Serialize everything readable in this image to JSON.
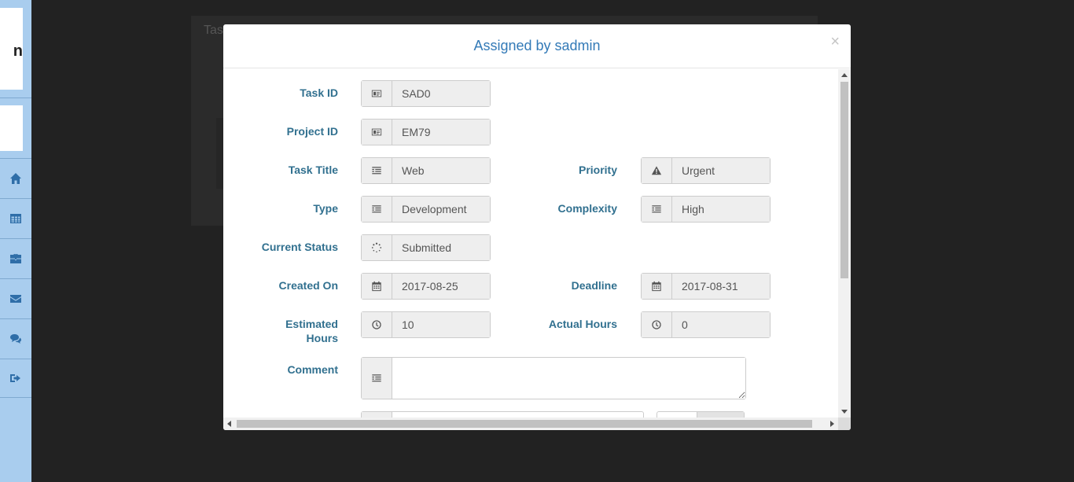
{
  "background": {
    "title": "Tas"
  },
  "sidebar": {
    "logo_letter": "n",
    "items": [
      {
        "icon": "home-icon"
      },
      {
        "icon": "table-icon"
      },
      {
        "icon": "briefcase-icon"
      },
      {
        "icon": "envelope-icon"
      },
      {
        "icon": "comments-icon"
      },
      {
        "icon": "sign-out-icon"
      }
    ]
  },
  "modal": {
    "title": "Assigned by sadmin",
    "close": "×",
    "fields": {
      "task_id": {
        "label": "Task ID",
        "value": "SAD0"
      },
      "project_id": {
        "label": "Project ID",
        "value": "EM79"
      },
      "task_title": {
        "label": "Task Title",
        "value": "Web"
      },
      "priority": {
        "label": "Priority",
        "value": "Urgent"
      },
      "type": {
        "label": "Type",
        "value": "Development"
      },
      "complexity": {
        "label": "Complexity",
        "value": "High"
      },
      "current_status": {
        "label": "Current Status",
        "value": "Submitted"
      },
      "created_on": {
        "label": "Created On",
        "value": "2017-08-25"
      },
      "deadline": {
        "label": "Deadline",
        "value": "2017-08-31"
      },
      "estimated_hours": {
        "label_line1": "Estimated",
        "label_line2": "Hours",
        "value": "10"
      },
      "actual_hours": {
        "label": "Actual Hours",
        "value": "0"
      },
      "comment": {
        "label": "Comment",
        "value": ""
      }
    }
  }
}
